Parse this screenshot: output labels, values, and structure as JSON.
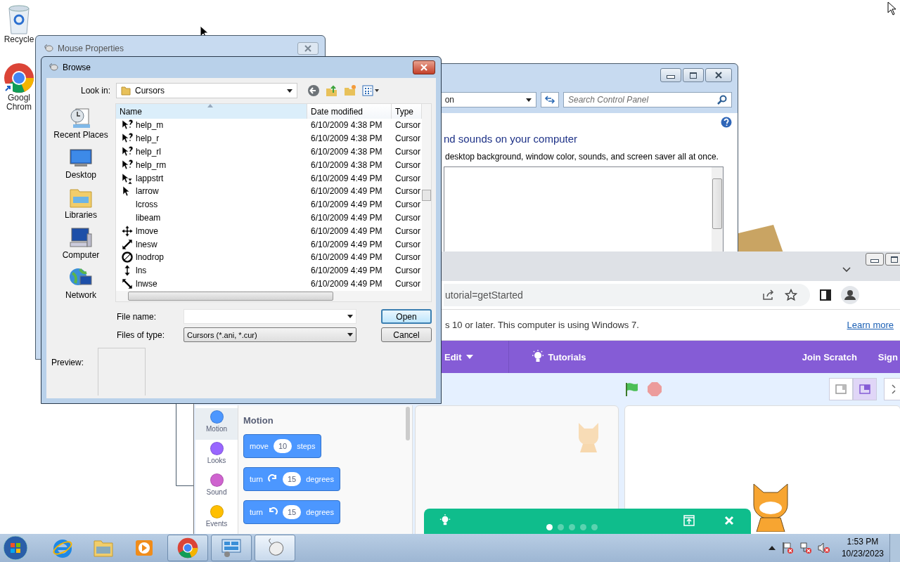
{
  "desktop": {
    "icons": [
      {
        "kind": "recycle",
        "lines": [
          "Recycle"
        ]
      },
      {
        "kind": "chrome",
        "lines": [
          "Googl",
          "Chrom"
        ]
      }
    ]
  },
  "control_panel": {
    "address": "on",
    "search": {
      "placeholder": "Search Control Panel"
    },
    "heading": "nd sounds on your computer",
    "description": "desktop background, window color, sounds, and screen saver all at once."
  },
  "mouse_properties": {
    "title": "Mouse Properties"
  },
  "browse": {
    "title": "Browse",
    "look_in_label": "Look in:",
    "look_in": "Cursors",
    "places": [
      {
        "kind": "recent",
        "label": "Recent Places"
      },
      {
        "kind": "desktop",
        "label": "Desktop"
      },
      {
        "kind": "libraries",
        "label": "Libraries"
      },
      {
        "kind": "computer",
        "label": "Computer"
      },
      {
        "kind": "network",
        "label": "Network"
      }
    ],
    "columns": [
      "Name",
      "Date modified",
      "Type"
    ],
    "rows": [
      {
        "kind": "help",
        "name": "help_m",
        "date": "6/10/2009 4:38 PM",
        "type": "Cursor"
      },
      {
        "kind": "help",
        "name": "help_r",
        "date": "6/10/2009 4:38 PM",
        "type": "Cursor"
      },
      {
        "kind": "help",
        "name": "help_rl",
        "date": "6/10/2009 4:38 PM",
        "type": "Cursor"
      },
      {
        "kind": "help",
        "name": "help_rm",
        "date": "6/10/2009 4:38 PM",
        "type": "Cursor"
      },
      {
        "kind": "busy",
        "name": "lappstrt",
        "date": "6/10/2009 4:49 PM",
        "type": "Cursor"
      },
      {
        "kind": "arrow",
        "name": "larrow",
        "date": "6/10/2009 4:49 PM",
        "type": "Cursor"
      },
      {
        "kind": "none",
        "name": "lcross",
        "date": "6/10/2009 4:49 PM",
        "type": "Cursor"
      },
      {
        "kind": "none",
        "name": "libeam",
        "date": "6/10/2009 4:49 PM",
        "type": "Cursor"
      },
      {
        "kind": "move",
        "name": "lmove",
        "date": "6/10/2009 4:49 PM",
        "type": "Cursor"
      },
      {
        "kind": "nesw",
        "name": "lnesw",
        "date": "6/10/2009 4:49 PM",
        "type": "Cursor"
      },
      {
        "kind": "nodrop",
        "name": "lnodrop",
        "date": "6/10/2009 4:49 PM",
        "type": "Cursor"
      },
      {
        "kind": "ns",
        "name": "lns",
        "date": "6/10/2009 4:49 PM",
        "type": "Cursor"
      },
      {
        "kind": "nwse",
        "name": "lnwse",
        "date": "6/10/2009 4:49 PM",
        "type": "Cursor"
      }
    ],
    "file_name_label": "File name:",
    "files_of_type_label": "Files of type:",
    "files_of_type": "Cursors (*.ani, *.cur)",
    "buttons": [
      {
        "label": "Open",
        "kind": "default"
      },
      {
        "label": "Cancel",
        "kind": "normal"
      }
    ],
    "preview_label": "Preview:"
  },
  "browser": {
    "address": "utorial=getStarted",
    "infobar": {
      "text": "s 10 or later. This computer is using Windows 7.",
      "link": "Learn more"
    },
    "menu": [
      {
        "kind": "dropdown",
        "label": "Edit"
      },
      {
        "kind": "tutorials",
        "label": "Tutorials"
      }
    ],
    "menu_right": [
      "Join Scratch",
      "Sign"
    ],
    "stage_modes": [
      {
        "selected": false
      },
      {
        "selected": true
      }
    ],
    "categories": [
      {
        "label": "Motion",
        "color": "#4c97ff",
        "selected": true
      },
      {
        "label": "Looks",
        "color": "#9966ff",
        "selected": false
      },
      {
        "label": "Sound",
        "color": "#cf63cf",
        "selected": false
      },
      {
        "label": "Events",
        "color": "#ffbf00",
        "selected": false
      }
    ],
    "palette_heading": "Motion",
    "blocks": [
      {
        "kind": "plain",
        "label": "move",
        "value": "10",
        "unit": "steps"
      },
      {
        "kind": "turn_right",
        "label": "turn",
        "value": "15",
        "unit": "degrees"
      },
      {
        "kind": "turn_left",
        "label": "turn",
        "value": "15",
        "unit": "degrees"
      }
    ],
    "tutorial_dots": [
      {
        "selected": true
      },
      {
        "selected": false
      },
      {
        "selected": false
      },
      {
        "selected": false
      },
      {
        "selected": false
      }
    ]
  },
  "taskbar": {
    "apps": [
      {
        "kind": "ie",
        "open": false,
        "selected": false
      },
      {
        "kind": "explorer",
        "open": false,
        "selected": false
      },
      {
        "kind": "media",
        "open": false,
        "selected": false
      },
      {
        "kind": "chrome",
        "open": true,
        "selected": false
      },
      {
        "kind": "control",
        "open": true,
        "selected": false
      },
      {
        "kind": "mouse",
        "open": true,
        "selected": true
      }
    ],
    "time": "1:53 PM",
    "date": "10/23/2023"
  }
}
